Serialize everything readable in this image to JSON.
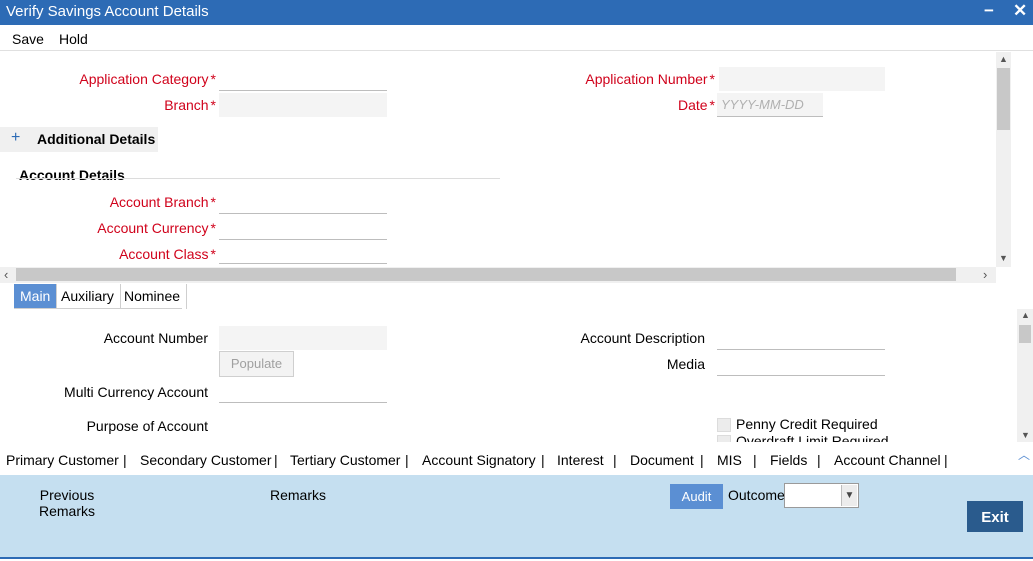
{
  "window": {
    "title": "Verify Savings Account Details",
    "minimize": "−",
    "close": "✕"
  },
  "menu": {
    "save": "Save",
    "hold": "Hold"
  },
  "header": {
    "application_category": "Application Category",
    "application_number": "Application Number",
    "branch": "Branch",
    "date": "Date",
    "date_placeholder": "YYYY-MM-DD",
    "required_star": "*"
  },
  "additional": {
    "toggle": "+",
    "label": "Additional Details"
  },
  "account_details": {
    "section_title": "Account Details",
    "account_branch": "Account Branch",
    "account_currency": "Account Currency",
    "account_class": "Account Class"
  },
  "tabs": [
    "Main",
    "Auxiliary",
    "Nominee"
  ],
  "main": {
    "account_number": "Account Number",
    "populate": "Populate",
    "multi_currency": "Multi Currency Account",
    "purpose": "Purpose of Account",
    "account_description": "Account Description",
    "media": "Media",
    "penny_credit": "Penny Credit Required",
    "overdraft_limit": "Overdraft Limit Required"
  },
  "bottom_nav": [
    "Primary Customer",
    "Secondary Customer",
    "Tertiary Customer",
    "Account Signatory",
    "Interest",
    "Document",
    "MIS",
    "Fields",
    "Account Channel"
  ],
  "bottom_sep": "|",
  "footer": {
    "previous_remarks": "Previous Remarks",
    "remarks": "Remarks",
    "audit": "Audit",
    "outcome": "Outcome",
    "outcome_value": "",
    "exit": "Exit"
  },
  "colors": {
    "titlebar": "#2d6bb5",
    "required": "#d0021b",
    "footer": "#c5dff0",
    "tab_active": "#5b8fd3",
    "exit": "#2a5b8d"
  },
  "icons": [
    "minimize-icon",
    "close-icon",
    "chevron-up-icon",
    "chevron-down-icon",
    "chevron-left-icon",
    "chevron-right-icon",
    "dropdown-arrow-icon"
  ]
}
